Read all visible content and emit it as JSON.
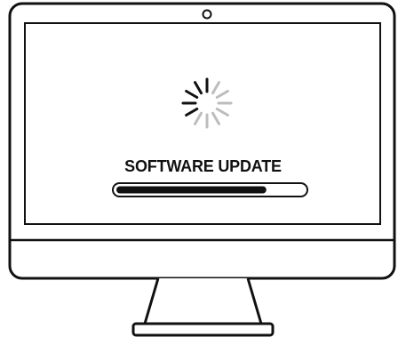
{
  "screen": {
    "title": "SOFTWARE UPDATE",
    "progress_fraction": 0.8,
    "spinner_icon": "loading-spinner-icon"
  },
  "colors": {
    "stroke": "#111111",
    "bezel_fill": "#ffffff",
    "progress_fill": "#111111",
    "spinner_dark": "#111111",
    "spinner_light": "#bdbdbd"
  }
}
